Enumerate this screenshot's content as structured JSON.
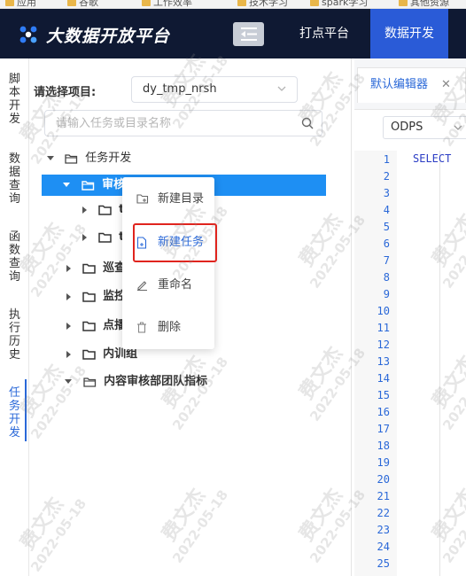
{
  "bookmarks": [
    "应用",
    "谷歌",
    "工作效率",
    "技术学习",
    "spark学习",
    "其他资源"
  ],
  "header": {
    "app_title": "大数据开放平台",
    "menu_toggle_icon": "menu-fold-icon",
    "nav": [
      "打点平台",
      "数据开发"
    ],
    "active_nav": "数据开发",
    "bg_color": "#0f1933",
    "active_color": "#2a5bd7"
  },
  "side_tabs": [
    {
      "label": "脚本开发",
      "active": false
    },
    {
      "label": "数据查询",
      "active": false
    },
    {
      "label": "函数查询",
      "active": false
    },
    {
      "label": "执行历史",
      "active": false
    },
    {
      "label": "任务开发",
      "active": true
    }
  ],
  "project": {
    "label": "请选择项目:",
    "selected": "dy_tmp_nrsh"
  },
  "search": {
    "placeholder": "请输入任务或目录名称"
  },
  "tree": {
    "root": "任务开发",
    "selected": "审核组",
    "sub1": "t",
    "sub2": "t",
    "items": [
      "巡查",
      "监控",
      "点播",
      "内训组",
      "内容审核部团队指标"
    ]
  },
  "context_menu": {
    "items": [
      "新建目录",
      "新建任务",
      "重命名",
      "删除"
    ],
    "highlighted": "新建任务"
  },
  "editor": {
    "tab_label": "默认编辑器",
    "engine": "ODPS",
    "first_line": "SELECT",
    "line_numbers": [
      "1",
      "2",
      "3",
      "4",
      "5",
      "6",
      "7",
      "8",
      "9",
      "10",
      "11",
      "12",
      "13",
      "14",
      "15",
      "16",
      "17",
      "18",
      "19",
      "20",
      "21",
      "22",
      "23",
      "24",
      "25"
    ]
  },
  "watermark": {
    "name": "费文杰",
    "date": "2022-05-18"
  }
}
